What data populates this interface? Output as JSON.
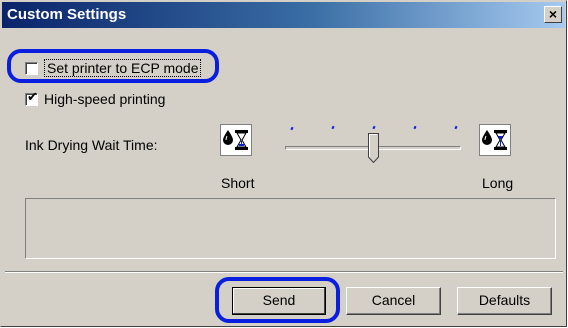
{
  "window": {
    "title": "Custom Settings",
    "close_glyph": "×"
  },
  "options": {
    "ecp_mode": {
      "label": "Set printer to ECP mode",
      "checked": false
    },
    "high_speed": {
      "label": "High-speed printing",
      "checked": true
    }
  },
  "ink_drying": {
    "label": "Ink Drying Wait Time:",
    "min_label": "Short",
    "max_label": "Long",
    "level": 0.5,
    "tick_count": 5,
    "icon_left": "ink-drop-hourglass-icon",
    "icon_right": "ink-drop-hourglass-icon"
  },
  "message": "",
  "buttons": {
    "send": "Send",
    "cancel": "Cancel",
    "defaults": "Defaults"
  },
  "colors": {
    "title_start": "#0a246a",
    "title_end": "#a6caf0",
    "callout": "#0a1ee0",
    "face": "#d4d0c8"
  }
}
